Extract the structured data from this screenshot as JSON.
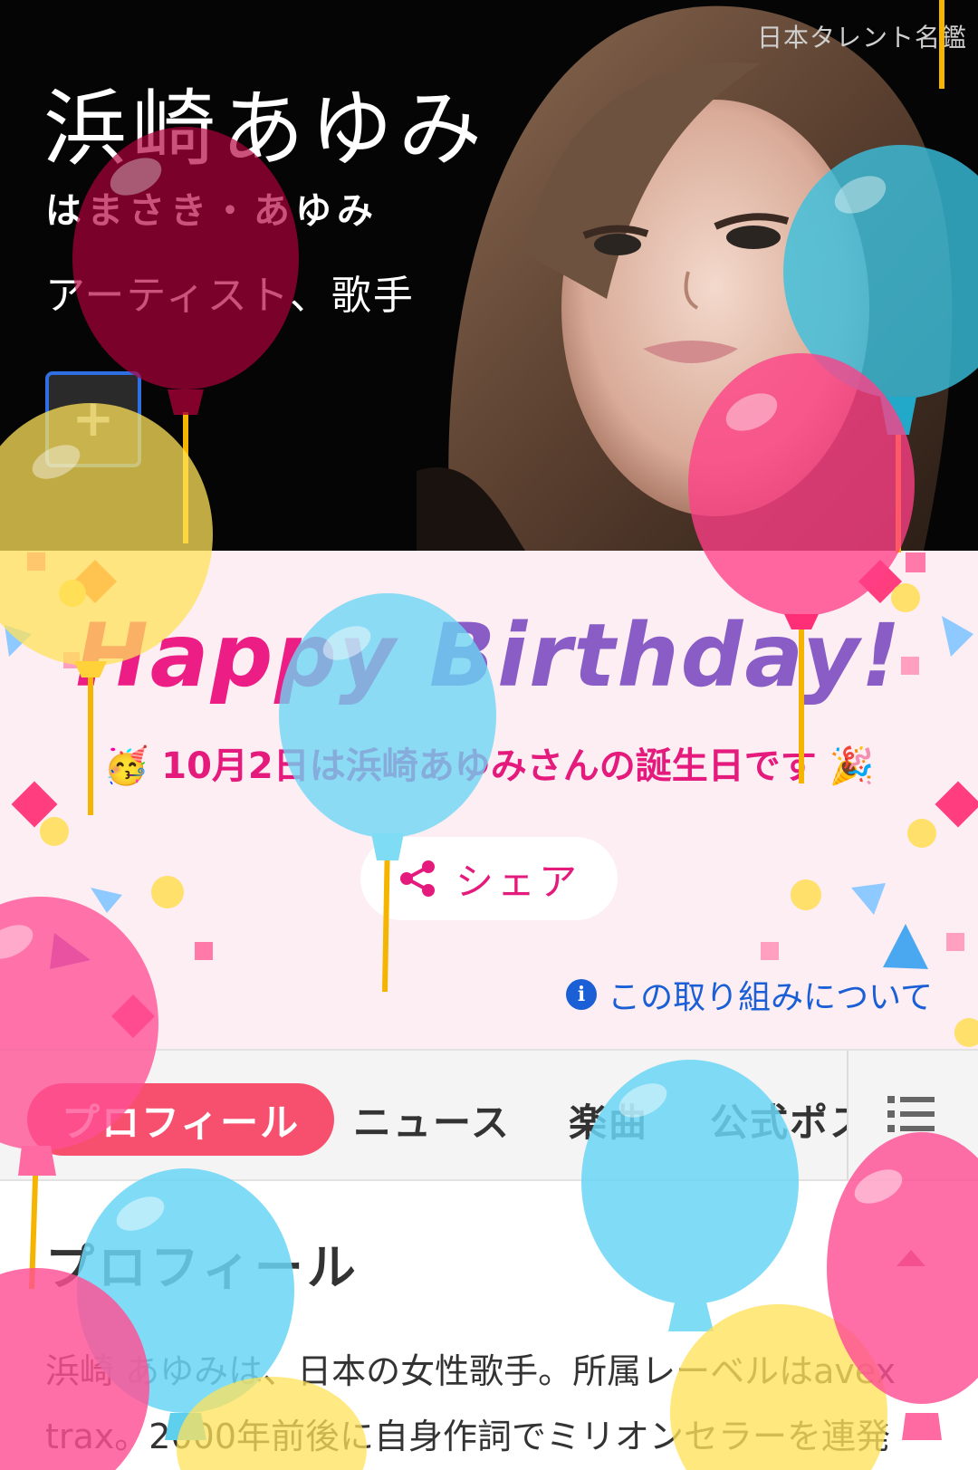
{
  "hero": {
    "source": "日本タレント名鑑",
    "name": "浜崎あゆみ",
    "kana": "はまさき・あゆみ",
    "role": "アーティスト、歌手",
    "add_button": "+"
  },
  "birthday": {
    "title_part1": "Happy ",
    "title_part2": "Birthday!",
    "message": "🥳 10月2日は浜崎あゆみさんの誕生日です 🎉",
    "share_label": "シェア",
    "about_link": "この取り組みについて"
  },
  "tabs": [
    {
      "label": "プロフィール",
      "active": true
    },
    {
      "label": "ニュース",
      "active": false
    },
    {
      "label": "楽曲",
      "active": false
    },
    {
      "label": "公式ポスト",
      "active": false
    }
  ],
  "profile": {
    "heading": "プロフィール",
    "body": "浜崎 あゆみは、日本の女性歌手。所属レーベルはavex trax。2000年前後に自身作詞でミリオンセラーを連発し……"
  },
  "colors": {
    "accent_pink": "#ec1e86",
    "tab_active": "#f7506e",
    "link_blue": "#1a5fd6",
    "banner_bg": "#fdeef3"
  },
  "icons": {
    "share": "share-icon",
    "info": "info-icon",
    "menu": "list-menu-icon",
    "scroll_top": "chevron-up-icon"
  }
}
